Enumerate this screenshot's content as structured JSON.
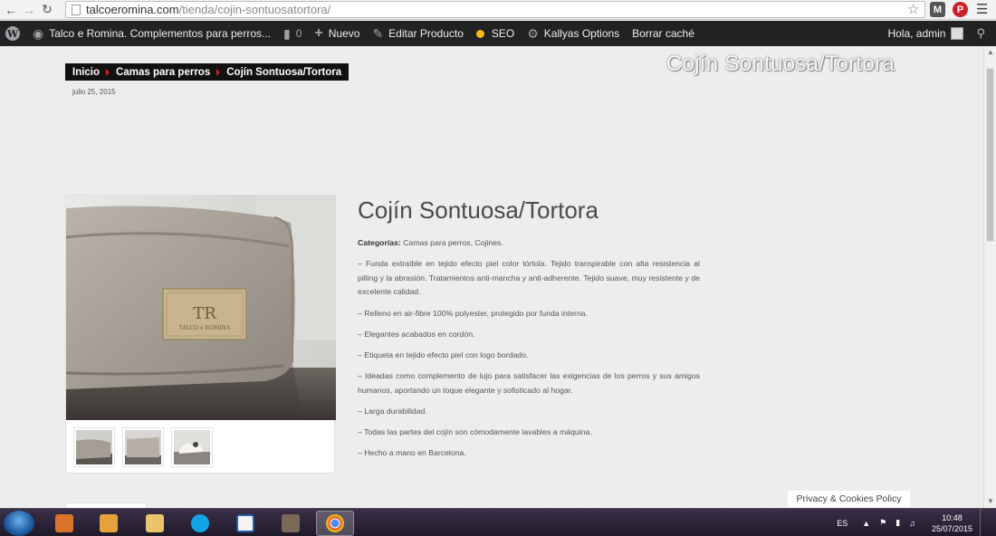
{
  "browser": {
    "url_domain": "talcoeromina.com",
    "url_path": "/tienda/cojin-sontuosatortora/",
    "back_icon": "back-arrow-icon",
    "forward_icon": "forward-arrow-icon",
    "reload_icon": "reload-icon",
    "star_icon": "bookmark-star-icon",
    "extensions": [
      "M",
      "P"
    ]
  },
  "admin_bar": {
    "site_name": "Talco e Romina. Complementos para perros...",
    "comments_count": "0",
    "new_label": "Nuevo",
    "edit_label": "Editar Producto",
    "seo_label": "SEO",
    "options_label": "Kallyas Options",
    "cache_label": "Borrar caché",
    "greeting": "Hola, admin"
  },
  "page": {
    "breadcrumb": [
      "Inicio",
      "Camas para perros",
      "Cojín Sontuosa/Tortora"
    ],
    "date": "julio 25, 2015",
    "hero_title": "Cojín Sontuosa/Tortora"
  },
  "product": {
    "title": "Cojín Sontuosa/Tortora",
    "categories_label": "Categorías:",
    "categories_value": "Camas para perros, Cojines.",
    "description": [
      "– Funda extraíble en tejido efecto piel color tórtola. Tejido transpirable con alta resistencia al pilling y la abrasión. Tratamientos anti-mancha y anti-adherente. Tejido suave, muy resistente y de excelente calidad.",
      "– Relleno en air-fibre 100% polyester, protegido por funda interna.",
      "– Elegantes acabados en cordón.",
      "– Etiqueta en tejido efecto piel con logo bordado.",
      "– Ideadas como complemento de lujo para satisfacer las exigencias de los perros y sus amigos humanos, aportando un toque elegante y sofisticado al hogar.",
      "– Larga durabilidad.",
      "– Todas las partes del cojín son cómodamente lavables a máquina.",
      "– Hecho a mano en Barcelona."
    ],
    "label_logo_text": [
      "TR",
      "TALCO e ROMINA"
    ]
  },
  "cookie_policy": "Privacy & Cookies Policy",
  "taskbar": {
    "language": "ES",
    "time": "10:48",
    "date": "25/07/2015"
  },
  "colors": {
    "accent_red": "#cd2122",
    "admin_bar": "#222222",
    "page_bg": "#ededed"
  }
}
